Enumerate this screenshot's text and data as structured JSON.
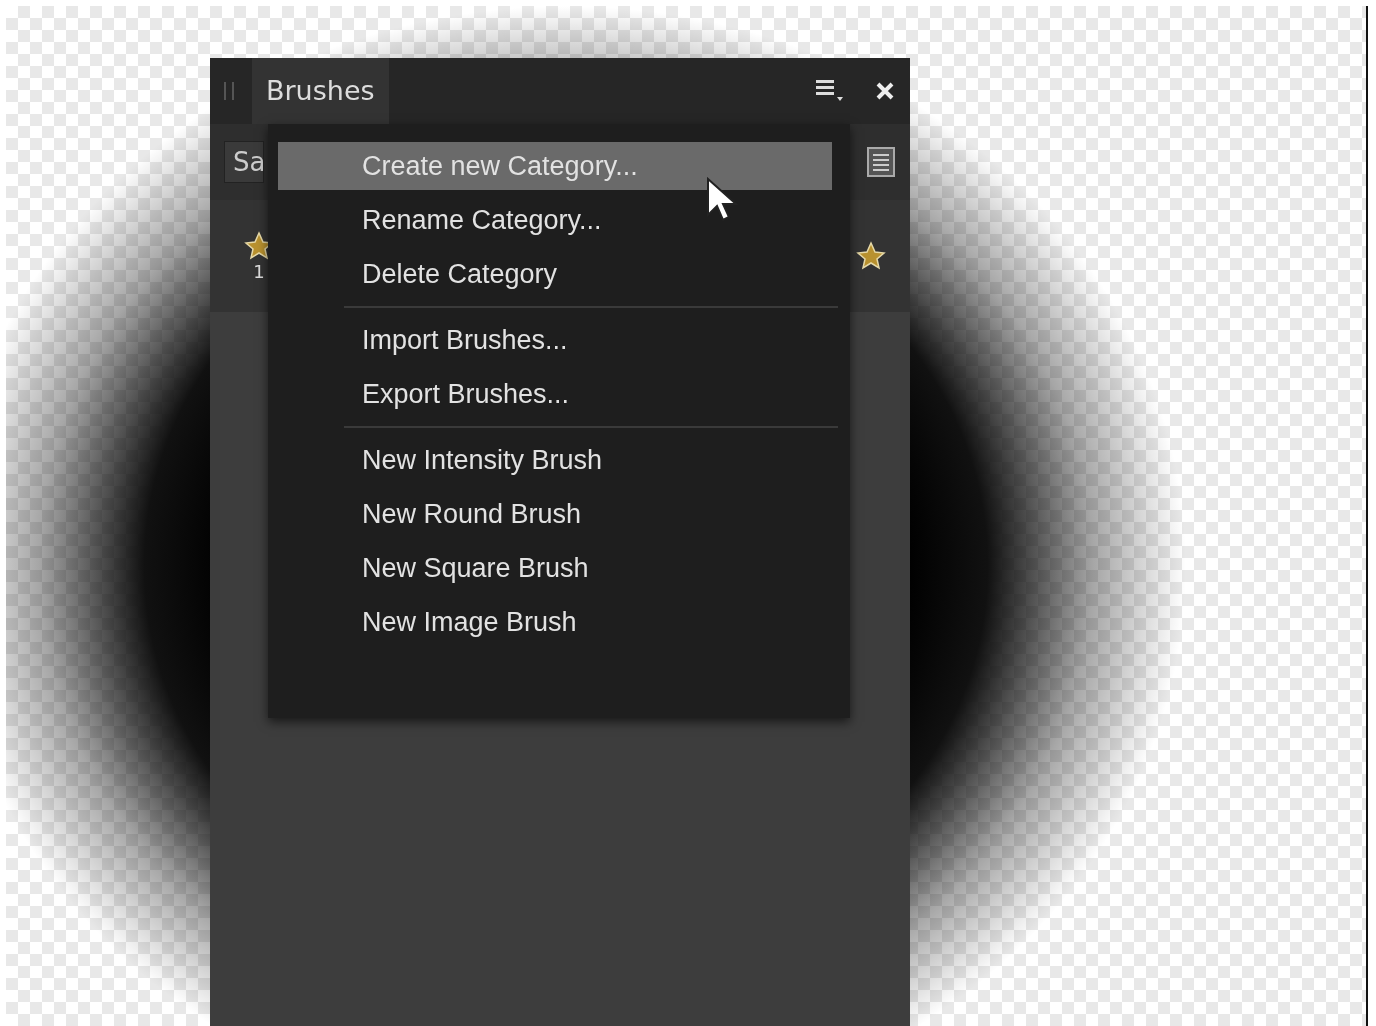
{
  "panel": {
    "title": "Brushes",
    "category_field": {
      "value": "Sa"
    },
    "brushes": [
      {
        "label": "1"
      }
    ]
  },
  "context_menu": {
    "sections": [
      {
        "items": [
          {
            "label": "Create new Category...",
            "selected": true
          },
          {
            "label": "Rename Category...",
            "selected": false
          },
          {
            "label": "Delete Category",
            "selected": false
          }
        ]
      },
      {
        "items": [
          {
            "label": "Import Brushes...",
            "selected": false
          },
          {
            "label": "Export Brushes...",
            "selected": false
          }
        ]
      },
      {
        "items": [
          {
            "label": "New Intensity Brush",
            "selected": false
          },
          {
            "label": "New Round Brush",
            "selected": false
          },
          {
            "label": "New Square Brush",
            "selected": false
          },
          {
            "label": "New Image Brush",
            "selected": false
          }
        ]
      }
    ]
  }
}
